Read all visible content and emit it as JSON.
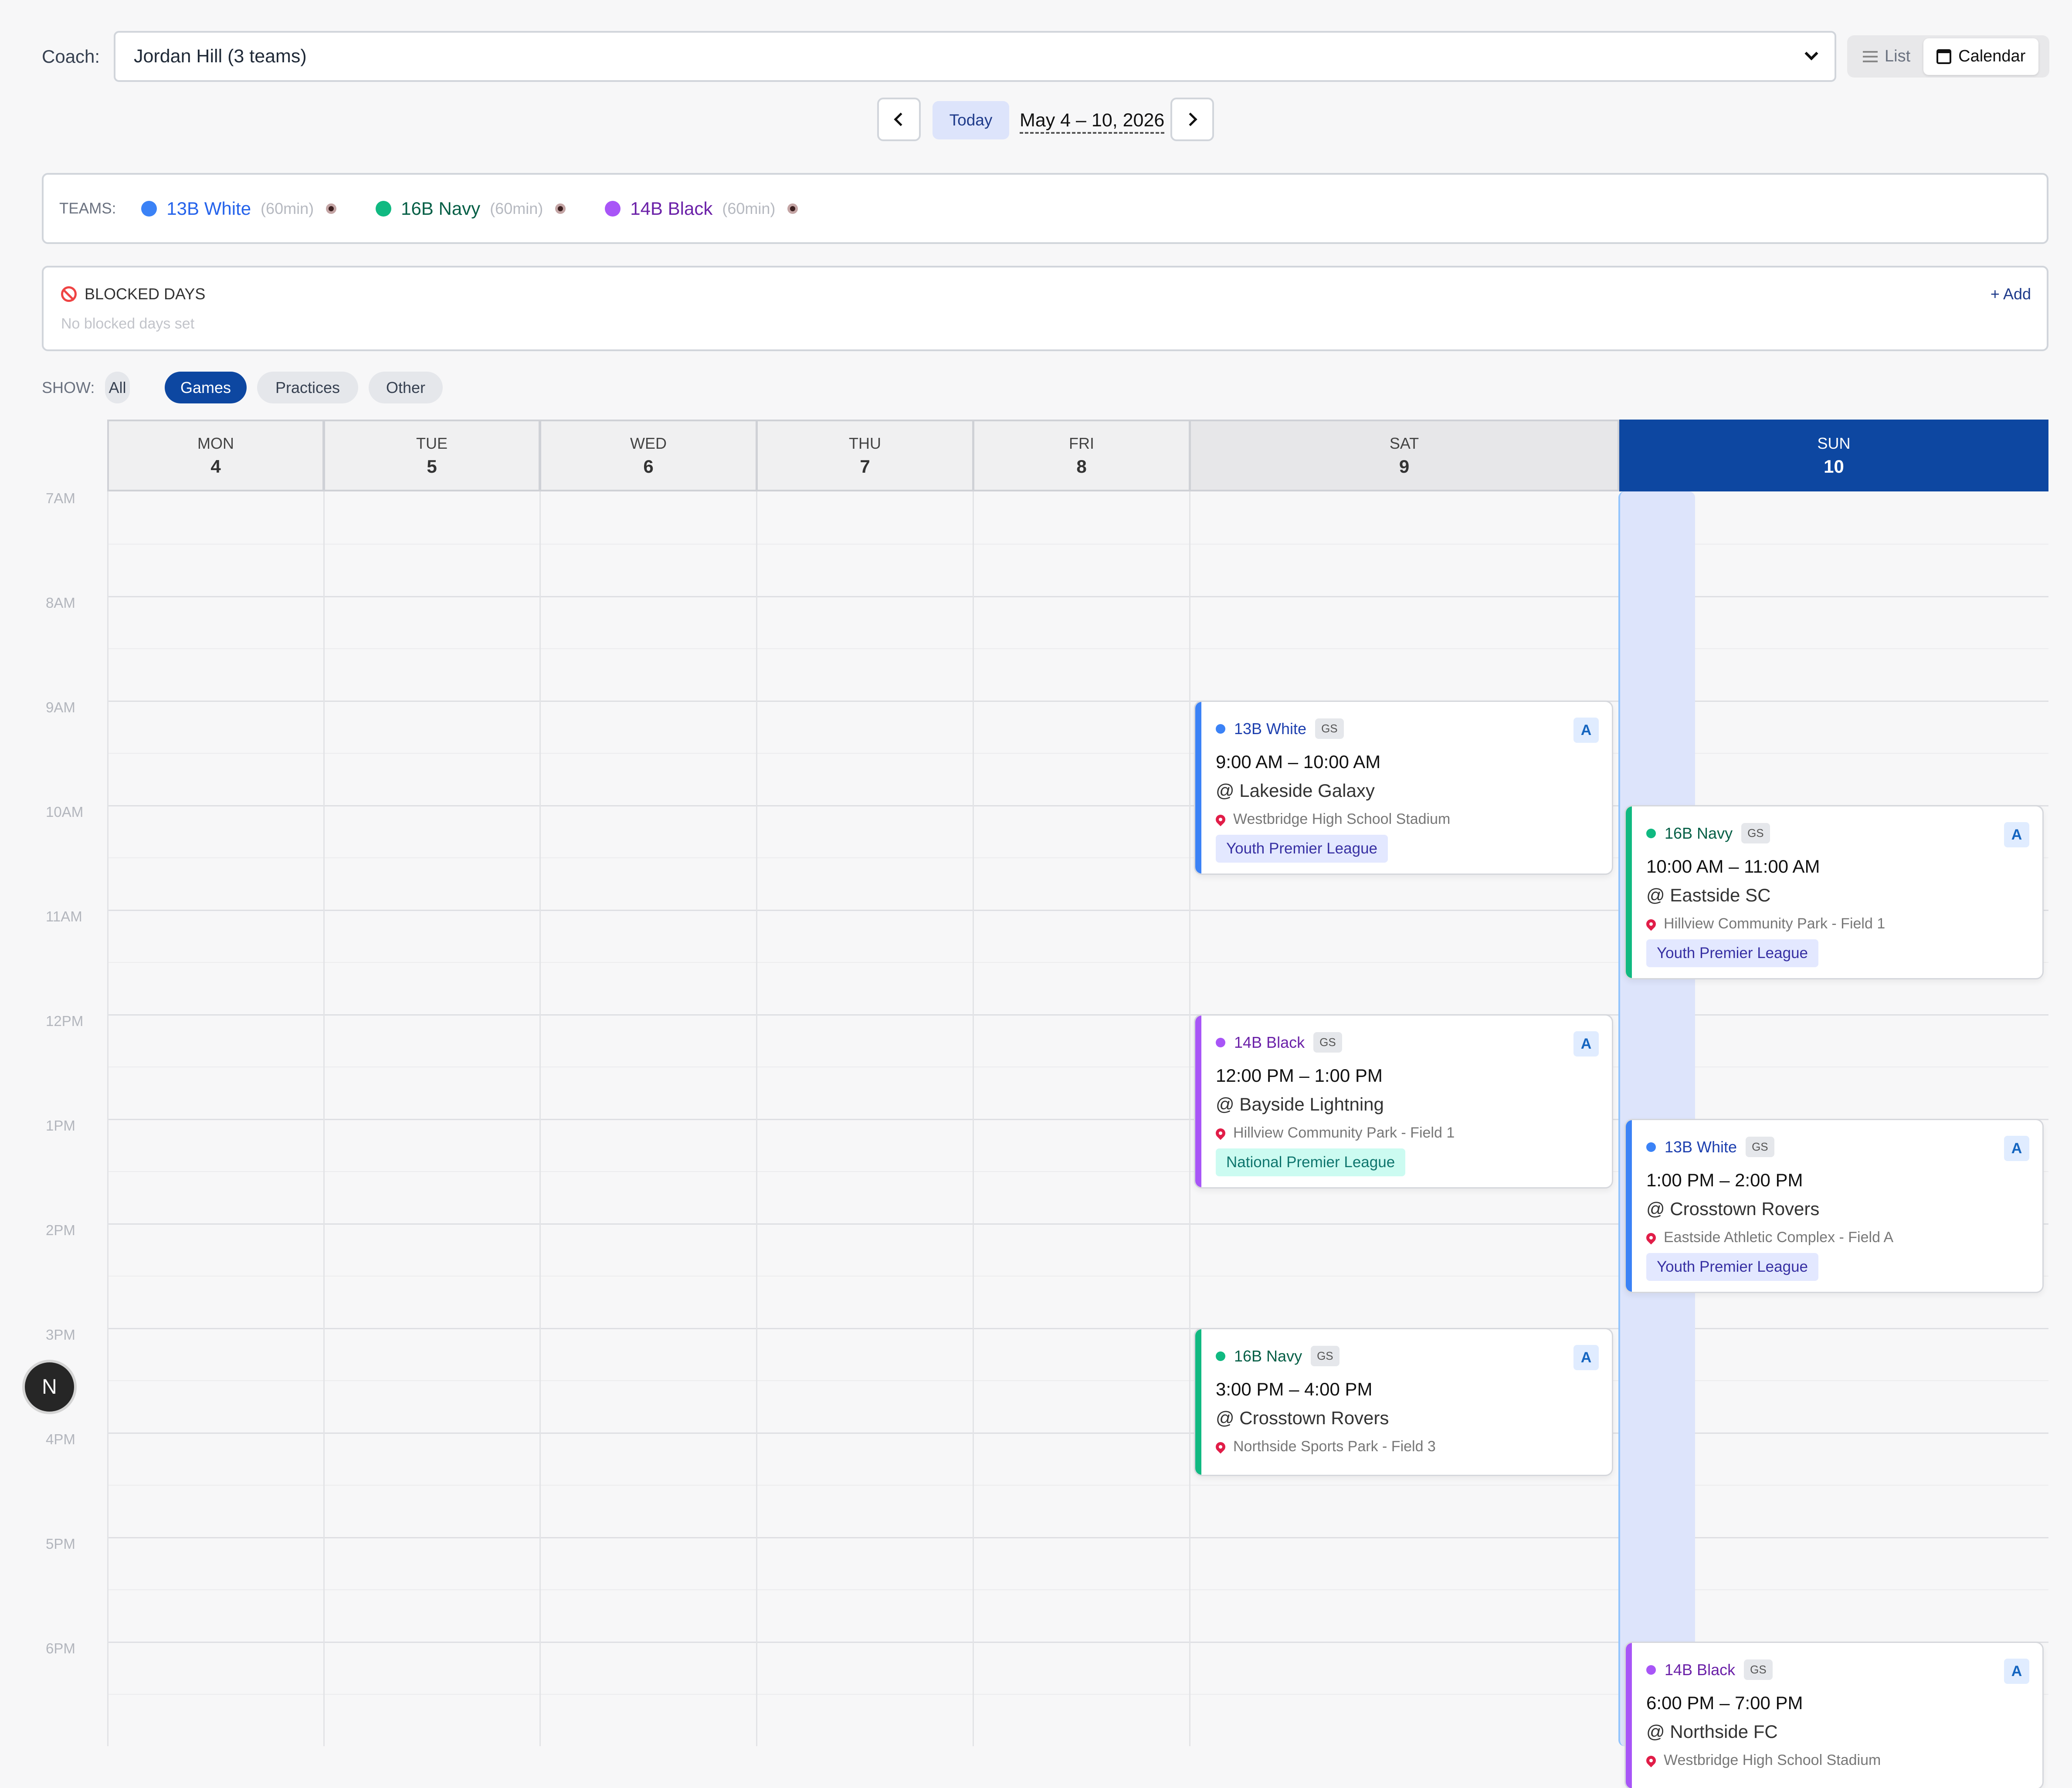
{
  "coach": {
    "label": "Coach:",
    "selected": "Jordan Hill (3 teams)"
  },
  "view_toggle": {
    "list": "List",
    "calendar": "Calendar"
  },
  "nav": {
    "today": "Today",
    "range": "May 4 – 10, 2026"
  },
  "teams": {
    "label": "TEAMS:",
    "items": [
      {
        "name": "13B White",
        "duration": "(60min)",
        "color": "#2563eb",
        "dot": "#3b82f6"
      },
      {
        "name": "16B Navy",
        "duration": "(60min)",
        "color": "#065f46",
        "dot": "#10b981"
      },
      {
        "name": "14B Black",
        "duration": "(60min)",
        "color": "#6b21a8",
        "dot": "#a855f7"
      }
    ]
  },
  "blocked": {
    "title": "BLOCKED DAYS",
    "empty": "No blocked days set",
    "add": "+ Add"
  },
  "filters": {
    "label": "SHOW:",
    "items": [
      "All",
      "Games",
      "Practices",
      "Other"
    ],
    "active": "Games"
  },
  "days": [
    {
      "name": "MON",
      "num": "4"
    },
    {
      "name": "TUE",
      "num": "5"
    },
    {
      "name": "WED",
      "num": "6"
    },
    {
      "name": "THU",
      "num": "7"
    },
    {
      "name": "FRI",
      "num": "8"
    },
    {
      "name": "SAT",
      "num": "9"
    },
    {
      "name": "SUN",
      "num": "10"
    }
  ],
  "hours": [
    "7AM",
    "8AM",
    "9AM",
    "10AM",
    "11AM",
    "12PM",
    "1PM",
    "2PM",
    "3PM",
    "4PM",
    "5PM",
    "6PM"
  ],
  "events": [
    {
      "team": "13B White",
      "badge": "GS",
      "ha": "A",
      "time": "9:00 AM – 10:00 AM",
      "opponent": "@ Lakeside Galaxy",
      "location": "Westbridge High School Stadium",
      "league": "Youth Premier League"
    },
    {
      "team": "16B Navy",
      "badge": "GS",
      "ha": "A",
      "time": "10:00 AM – 11:00 AM",
      "opponent": "@ Eastside SC",
      "location": "Hillview Community Park - Field 1",
      "league": "Youth Premier League"
    },
    {
      "team": "14B Black",
      "badge": "GS",
      "ha": "A",
      "time": "12:00 PM – 1:00 PM",
      "opponent": "@ Bayside Lightning",
      "location": "Hillview Community Park - Field 1",
      "league": "National Premier League"
    },
    {
      "team": "13B White",
      "badge": "GS",
      "ha": "A",
      "time": "1:00 PM – 2:00 PM",
      "opponent": "@ Crosstown Rovers",
      "location": "Eastside Athletic Complex - Field A",
      "league": "Youth Premier League"
    },
    {
      "team": "16B Navy",
      "badge": "GS",
      "ha": "A",
      "time": "3:00 PM – 4:00 PM",
      "opponent": "@ Crosstown Rovers",
      "location": "Northside Sports Park - Field 3",
      "league": ""
    },
    {
      "team": "14B Black",
      "badge": "GS",
      "ha": "A",
      "time": "6:00 PM – 7:00 PM",
      "opponent": "@ Northside FC",
      "location": "Westbridge High School Stadium",
      "league": ""
    }
  ],
  "user_badge": "N"
}
